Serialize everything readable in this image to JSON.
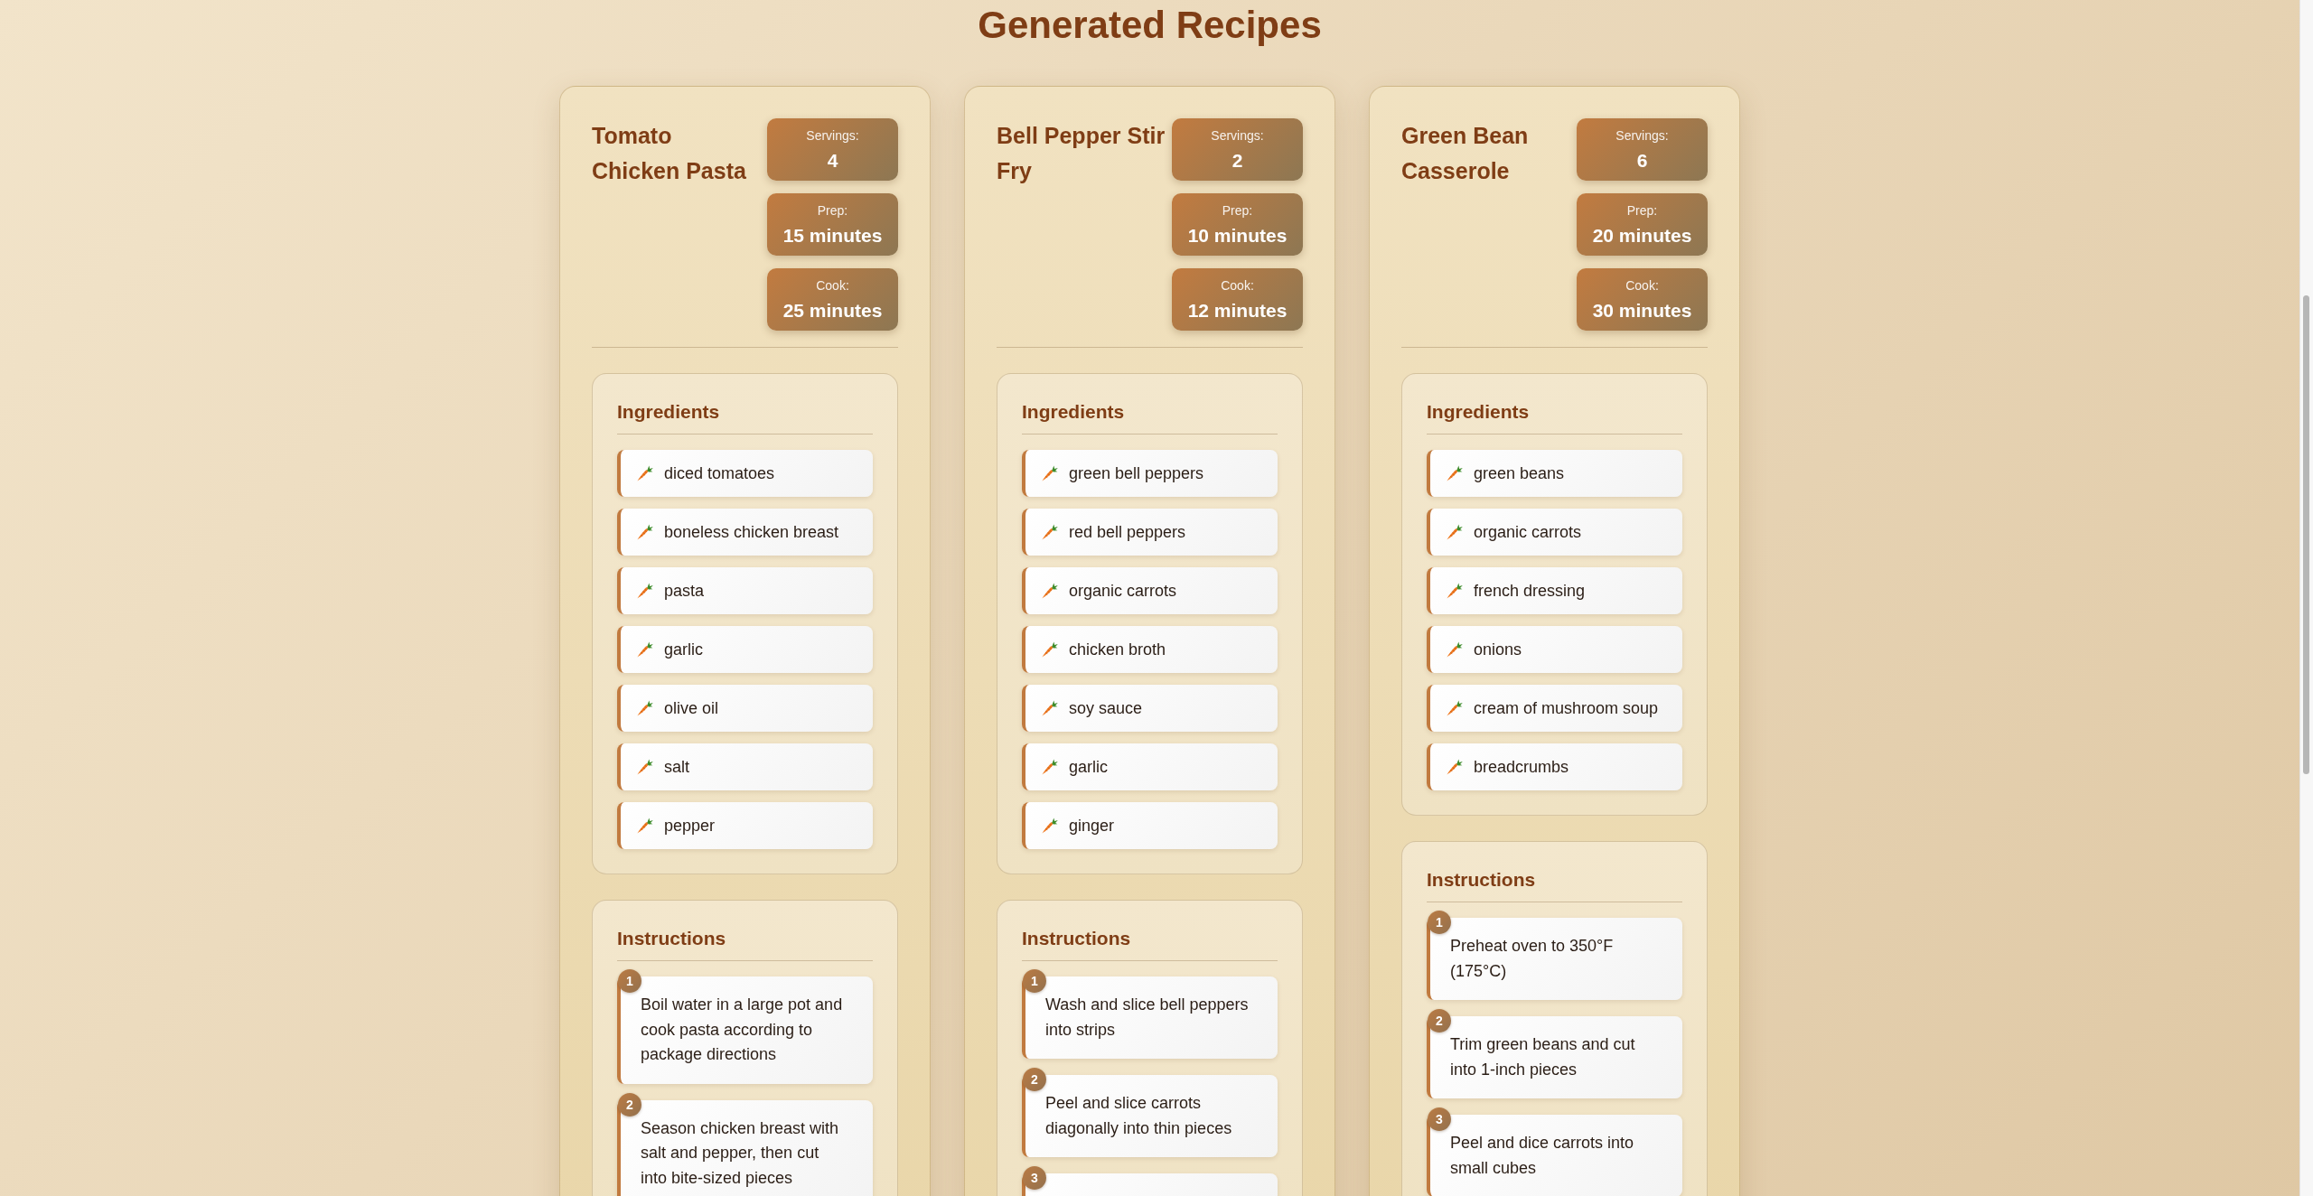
{
  "page_title": "Generated Recipes",
  "recipes": [
    {
      "title": "Tomato Chicken Pasta",
      "stats": [
        {
          "label": "Servings:",
          "value": "4"
        },
        {
          "label": "Prep:",
          "value": "15 minutes"
        },
        {
          "label": "Cook:",
          "value": "25 minutes"
        }
      ],
      "ingredients_heading": "Ingredients",
      "ingredients": [
        "diced tomatoes",
        "boneless chicken breast",
        "pasta",
        "garlic",
        "olive oil",
        "salt",
        "pepper"
      ],
      "instructions_heading": "Instructions",
      "instructions": [
        {
          "number": "1",
          "text": "Boil water in a large pot and cook pasta according to package directions"
        },
        {
          "number": "2",
          "text": "Season chicken breast with salt and pepper, then cut into bite-sized pieces"
        }
      ]
    },
    {
      "title": "Bell Pepper Stir Fry",
      "stats": [
        {
          "label": "Servings:",
          "value": "2"
        },
        {
          "label": "Prep:",
          "value": "10 minutes"
        },
        {
          "label": "Cook:",
          "value": "12 minutes"
        }
      ],
      "ingredients_heading": "Ingredients",
      "ingredients": [
        "green bell peppers",
        "red bell peppers",
        "organic carrots",
        "chicken broth",
        "soy sauce",
        "garlic",
        "ginger"
      ],
      "instructions_heading": "Instructions",
      "instructions": [
        {
          "number": "1",
          "text": "Wash and slice bell peppers into strips"
        },
        {
          "number": "2",
          "text": "Peel and slice carrots diagonally into thin pieces"
        },
        {
          "number": "3"
        }
      ]
    },
    {
      "title": "Green Bean Casserole",
      "stats": [
        {
          "label": "Servings:",
          "value": "6"
        },
        {
          "label": "Prep:",
          "value": "20 minutes"
        },
        {
          "label": "Cook:",
          "value": "30 minutes"
        }
      ],
      "ingredients_heading": "Ingredients",
      "ingredients": [
        "green beans",
        "organic carrots",
        "french dressing",
        "onions",
        "cream of mushroom soup",
        "breadcrumbs"
      ],
      "instructions_heading": "Instructions",
      "instructions": [
        {
          "number": "1",
          "text": "Preheat oven to 350°F (175°C)"
        },
        {
          "number": "2",
          "text": "Trim green beans and cut into 1-inch pieces"
        },
        {
          "number": "3",
          "text": "Peel and dice carrots into small cubes"
        }
      ]
    }
  ]
}
